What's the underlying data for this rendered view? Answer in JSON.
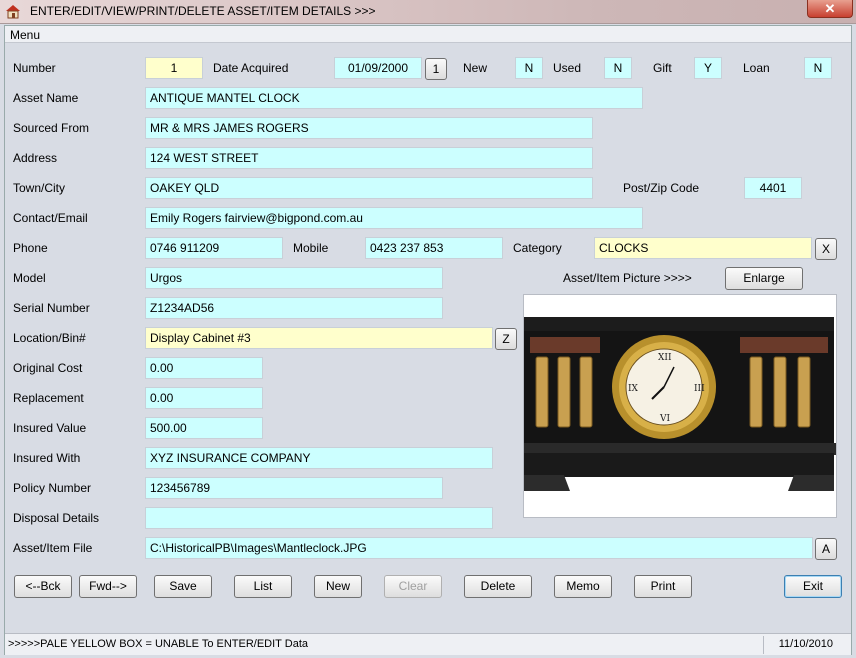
{
  "window": {
    "title": "ENTER/EDIT/VIEW/PRINT/DELETE ASSET/ITEM DETAILS >>>",
    "close_label": "✕"
  },
  "menu": {
    "label": "Menu"
  },
  "labels": {
    "number": "Number",
    "date_acquired": "Date Acquired",
    "new": "New",
    "used": "Used",
    "gift": "Gift",
    "loan": "Loan",
    "asset_name": "Asset Name",
    "sourced_from": "Sourced From",
    "address": "Address",
    "town_city": "Town/City",
    "post_zip": "Post/Zip Code",
    "contact_email": "Contact/Email",
    "phone": "Phone",
    "mobile": "Mobile",
    "category": "Category",
    "model": "Model",
    "picture_caption": "Asset/Item Picture >>>>",
    "serial_number": "Serial Number",
    "location_bin": "Location/Bin#",
    "original_cost": "Original Cost",
    "replacement": "Replacement",
    "insured_value": "Insured Value",
    "insured_with": "Insured With",
    "policy_number": "Policy Number",
    "disposal_details": "Disposal Details",
    "asset_file": "Asset/Item File"
  },
  "values": {
    "number": "1",
    "date_acquired": "01/09/2000",
    "new": "N",
    "used": "N",
    "gift": "Y",
    "loan": "N",
    "asset_name": "ANTIQUE MANTEL CLOCK",
    "sourced_from": "MR & MRS JAMES ROGERS",
    "address": "124 WEST STREET",
    "town_city": "OAKEY QLD",
    "post_zip": "4401",
    "contact_email": "Emily Rogers  fairview@bigpond.com.au",
    "phone": "0746 911209",
    "mobile": "0423 237 853",
    "category": "CLOCKS",
    "model": "Urgos",
    "serial_number": "Z1234AD56",
    "location_bin": "Display Cabinet #3",
    "original_cost": "0.00",
    "replacement": "0.00",
    "insured_value": "500.00",
    "insured_with": "XYZ INSURANCE COMPANY",
    "policy_number": "123456789",
    "disposal_details": "",
    "asset_file": "C:\\HistoricalPB\\Images\\Mantleclock.JPG"
  },
  "small_buttons": {
    "date": "1",
    "category": "X",
    "location": "Z",
    "file": "A"
  },
  "enlarge_label": "Enlarge",
  "buttons": {
    "back": "<--Bck",
    "fwd": "Fwd-->",
    "save": "Save",
    "list": "List",
    "new": "New",
    "clear": "Clear",
    "delete": "Delete",
    "memo": "Memo",
    "print": "Print",
    "exit": "Exit"
  },
  "status": {
    "message": ">>>>>PALE YELLOW BOX = UNABLE To ENTER/EDIT Data",
    "date": "11/10/2010"
  },
  "picture": {
    "subject": "mantel-clock-photo",
    "accent": "#c8a040"
  }
}
